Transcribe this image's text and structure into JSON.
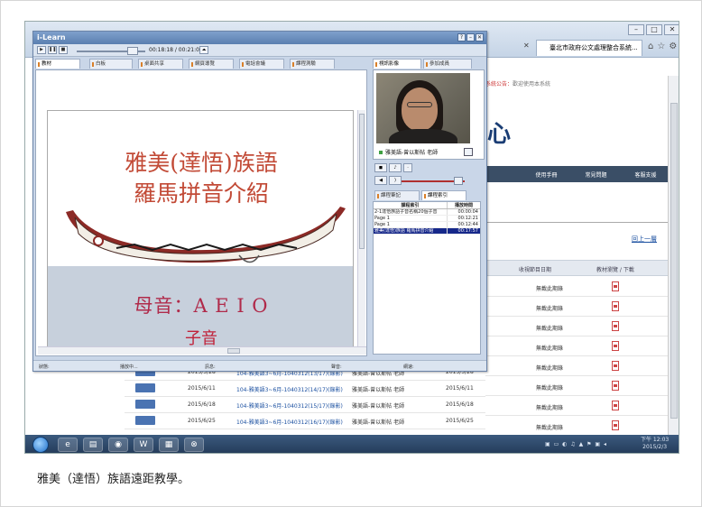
{
  "browser": {
    "tab_title": "臺北市政府公文處理整合系統...",
    "notice_label": "系統公告：",
    "notice_text": "歡迎使用本系統",
    "big_char": "心",
    "nav": [
      "使用手冊",
      "常見問題",
      "客服支援"
    ],
    "back_link": "回上一層",
    "table_headers": [
      "收視節目日期",
      "教材瀏覽 / 下載"
    ],
    "right_status": "無載此期錄",
    "right_rows": 8,
    "left_rows": [
      {
        "date1": "2015/5/28",
        "title": "104-雅美語3~6月-1040312(13/17)(錄影)",
        "teacher": "雅美語-曾以斯帖 老師",
        "date2": "2015/5/28"
      },
      {
        "date1": "2015/6/11",
        "title": "104-雅美語3~6月-1040312(14/17)(錄影)",
        "teacher": "雅美語-曾以斯帖 老師",
        "date2": "2015/6/11"
      },
      {
        "date1": "2015/6/18",
        "title": "104-雅美語3~6月-1040312(15/17)(錄影)",
        "teacher": "雅美語-曾以斯帖 老師",
        "date2": "2015/6/18"
      },
      {
        "date1": "2015/6/25",
        "title": "104-雅美語3~6月-1040312(16/17)(錄影)",
        "teacher": "雅美語-曾以斯帖 老師",
        "date2": "2015/6/25"
      }
    ]
  },
  "ilearn": {
    "title": "i-Learn",
    "time": "00:18:18 / 00:21:04",
    "tabs": [
      "教材",
      "白板",
      "桌面共享",
      "網頁導覽",
      "電話會議",
      "課程測驗"
    ],
    "video_tabs": [
      "視訊影像",
      "參加成員"
    ],
    "video_name": "雅美語-曾以斯帖 老師",
    "index_tabs": [
      "課程筆記",
      "課程索引"
    ],
    "index_headers": [
      "課程索引",
      "播放時間"
    ],
    "index_rows": [
      {
        "label": "2-1達悟族語子音名稱20個子音",
        "time": "00:00:04",
        "selected": false
      },
      {
        "label": "Page 1",
        "time": "00:12:21",
        "selected": false
      },
      {
        "label": "Page 1",
        "time": "00:12:44",
        "selected": false
      },
      {
        "label": "雅美(達悟)族語 羅馬拼音介紹",
        "time": "00:17:57",
        "selected": true
      }
    ],
    "status": [
      "狀態:",
      "播放中...",
      "訊息:",
      "聲音:",
      "網速:"
    ]
  },
  "slide": {
    "title_line1": "雅美(達悟)族語",
    "title_line2": "羅馬拼音介紹",
    "vowels": "母音：A E I O",
    "consonants": "子音"
  },
  "taskbar": {
    "clock_time": "下午 12:03",
    "clock_date": "2015/2/3"
  },
  "caption": "雅美（達悟）族語遠距教學。"
}
